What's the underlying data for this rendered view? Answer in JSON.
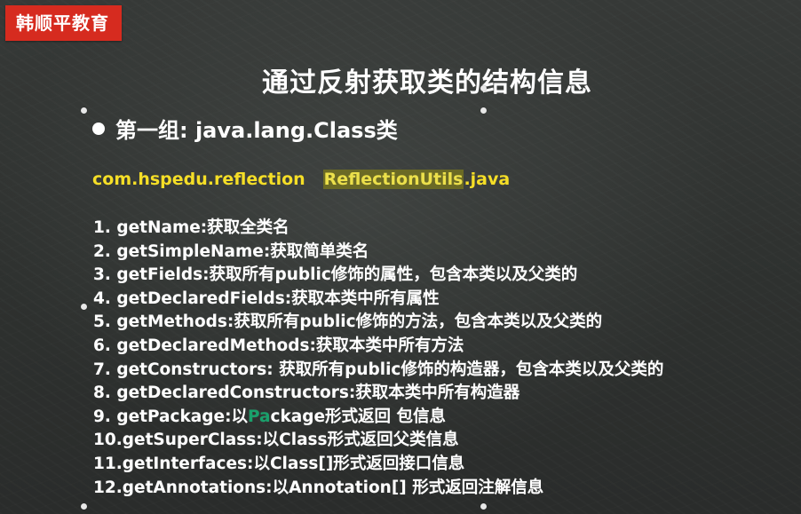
{
  "brand": {
    "label": "韩顺平教育",
    "color": "#d62b1f"
  },
  "title": "通过反射获取类的结构信息",
  "section": {
    "bullet_icon": "filled-circle",
    "heading": "第一组: java.lang.Class类"
  },
  "source": {
    "package": "com.hspedu.reflection",
    "class_highlighted": "ReflectionUtils",
    "extension": ".java",
    "color": "#f5de27"
  },
  "methods": [
    {
      "num": "1.",
      "text": " getName:获取全类名"
    },
    {
      "num": "2.",
      "text": " getSimpleName:获取简单类名"
    },
    {
      "num": "3.",
      "text": " getFields:获取所有public修饰的属性，包含本类以及父类的"
    },
    {
      "num": "4.",
      "text": " getDeclaredFields:获取本类中所有属性"
    },
    {
      "num": "5.",
      "text": " getMethods:获取所有public修饰的方法，包含本类以及父类的"
    },
    {
      "num": "6.",
      "text": " getDeclaredMethods:获取本类中所有方法"
    },
    {
      "num": "7.",
      "text": " getConstructors: 获取所有public修饰的构造器，包含本类以及父类的"
    },
    {
      "num": "8.",
      "text": " getDeclaredConstructors:获取本类中所有构造器"
    },
    {
      "num": "9.",
      "text_before": " getPackage:以",
      "text_cursor": "Pa",
      "text_after": "ckage形式返回 包信息"
    },
    {
      "num": "10.",
      "text": "getSuperClass:以Class形式返回父类信息"
    },
    {
      "num": "11.",
      "text": "getInterfaces:以Class[]形式返回接口信息"
    },
    {
      "num": "12.",
      "text": "getAnnotations:以Annotation[] 形式返回注解信息"
    }
  ]
}
